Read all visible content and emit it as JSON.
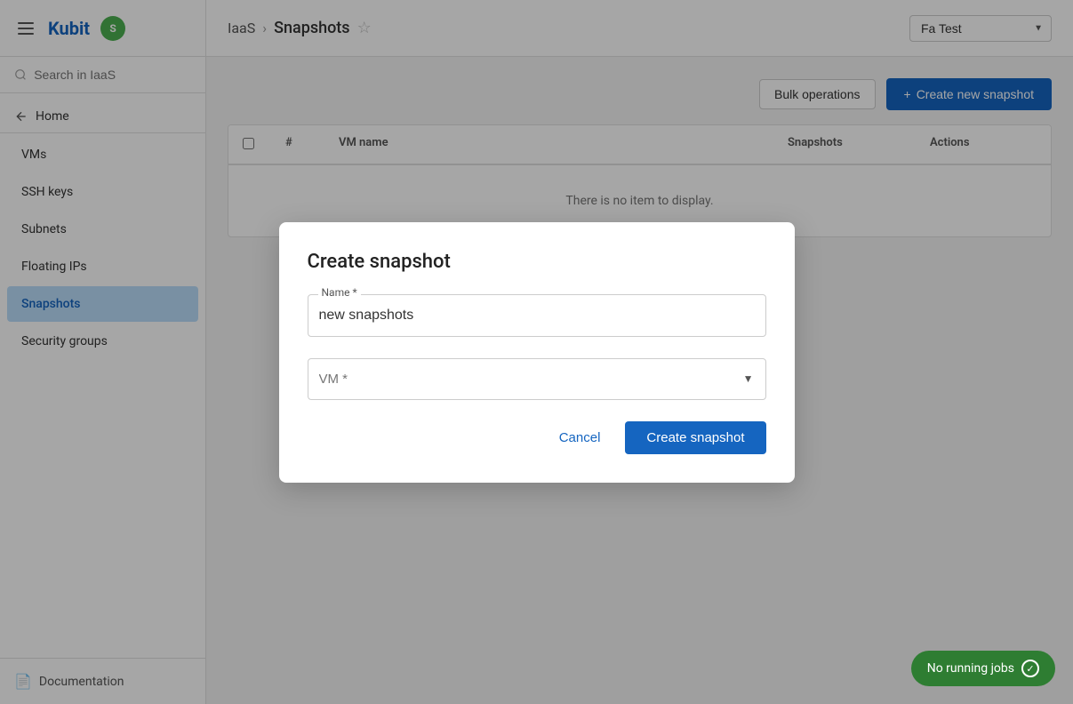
{
  "sidebar": {
    "logo_text": "Kubit",
    "search_placeholder": "Search in IaaS",
    "home_label": "Home",
    "nav_items": [
      {
        "id": "vms",
        "label": "VMs",
        "active": false
      },
      {
        "id": "ssh-keys",
        "label": "SSH keys",
        "active": false
      },
      {
        "id": "subnets",
        "label": "Subnets",
        "active": false
      },
      {
        "id": "floating-ips",
        "label": "Floating IPs",
        "active": false
      },
      {
        "id": "snapshots",
        "label": "Snapshots",
        "active": true
      },
      {
        "id": "security-groups",
        "label": "Security groups",
        "active": false
      }
    ],
    "footer_label": "Documentation"
  },
  "topbar": {
    "breadcrumb_root": "IaaS",
    "breadcrumb_current": "Snapshots",
    "tenant_name": "Fa Test"
  },
  "page": {
    "bulk_operations_label": "Bulk operations",
    "create_button_label": "Create new snapshot",
    "table": {
      "columns": [
        "#",
        "VM name",
        "Snapshots",
        "Actions"
      ],
      "empty_message": "There is no item to display."
    }
  },
  "modal": {
    "title": "Create snapshot",
    "name_label": "Name *",
    "name_value": "new snapshots",
    "vm_label": "VM *",
    "vm_placeholder": "VM *",
    "cancel_label": "Cancel",
    "confirm_label": "Create snapshot"
  },
  "jobs_badge": {
    "label": "No running jobs"
  }
}
